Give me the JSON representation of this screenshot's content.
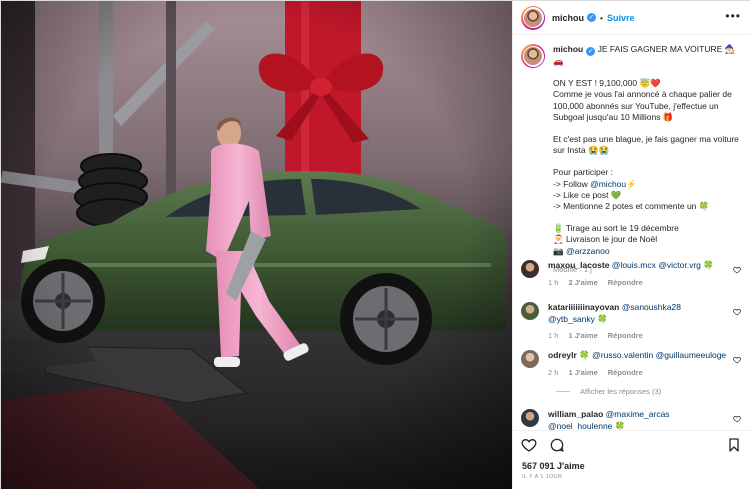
{
  "post": {
    "author": "michou",
    "follow_label": "Suivre",
    "dot": "•",
    "more": "•••",
    "verified_mark": "✓"
  },
  "caption": {
    "username": "michou",
    "title_text": " JE FAIS GAGNER MA VOITURE 🧙‍♂️🚗",
    "p1_line1": "ON Y EST ! 9,100,000 😇❤️",
    "p1_line2": "Comme je vous l'ai annoncé à chaque palier de",
    "p1_line3": "100,000 abonnés sur YouTube, j'effectue un",
    "p1_line4": "Subgoal jusqu'au 10 Millions 🎁",
    "p2_line1": "Et c'est pas une blague, je fais gagner ma voiture",
    "p2_line2": "sur Insta 😭😭",
    "p3_intro": "Pour participer :",
    "p3_step1_a": "-> Follow ",
    "p3_step1_mention": "@michou",
    "p3_step1_b": "⚡",
    "p3_step2": "-> Like ce post 💚",
    "p3_step3": "-> Mentionne 2 potes et commente un 🍀",
    "p4_line1": "🔋 Tirage au sort le 19 décembre",
    "p4_line2": "🎅 Livraison le jour de Noël",
    "p4_line3_icon": "📷 ",
    "p4_line3_mention": "@arzzanoo",
    "meta": "Modifié · 1 j"
  },
  "comments": [
    {
      "user": "maxou_lacoste",
      "text1": "@louis.mcx",
      "text2": "@victor.vrg",
      "emoji": " 🍀",
      "time": "1 h",
      "likes": "2 J'aime",
      "reply": "Répondre"
    },
    {
      "user": "katariiiiiiinayovan",
      "text1": "@sanoushka28",
      "text2": "@ytb_sanky",
      "emoji": "🍀",
      "time": "1 h",
      "likes": "1 J'aime",
      "reply": "Répondre"
    },
    {
      "user": "odreylr",
      "emoji_pre": "🍀",
      "text1": "@russo.valentin",
      "text2": "@guillaumeeuloge",
      "time": "2 h",
      "likes": "1 J'aime",
      "reply": "Répondre"
    },
    {
      "user": "william_palao",
      "text1": "@maxime_arcas",
      "text2": "@noel_houlenne",
      "emoji": "🍀"
    }
  ],
  "replies_label": "Afficher les réponses (3)",
  "engagement": {
    "likes": "567 091 J'aime",
    "posted": "IL Y A 1 JOUR"
  },
  "colors": {
    "accent": "#0095f6",
    "mention": "#00376b",
    "muted": "#8e8e8e",
    "car_green": "#3f5a34",
    "tracksuit_pink": "#f2a6c8",
    "ribbon_red": "#c0182a"
  },
  "icons": {
    "heart": "heart-icon",
    "comment": "comment-icon",
    "save": "bookmark-icon",
    "more": "more-options-icon",
    "verified": "verified-badge-icon"
  }
}
